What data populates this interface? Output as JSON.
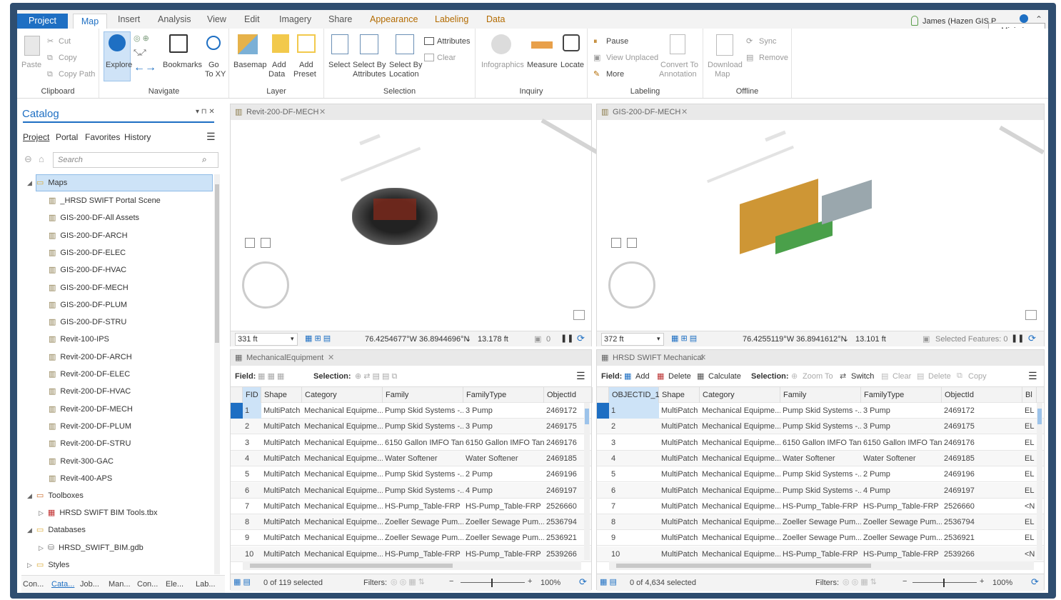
{
  "tabs": [
    "Project",
    "Map",
    "Insert",
    "Analysis",
    "View",
    "Edit",
    "Imagery",
    "Share",
    "Appearance",
    "Labeling",
    "Data"
  ],
  "user": "James (Hazen GIS P",
  "tooltip": "Minimize",
  "ribbon": {
    "clipboard": {
      "label": "Clipboard",
      "paste": "Paste",
      "cut": "Cut",
      "copy": "Copy",
      "copy_path": "Copy Path"
    },
    "navigate": {
      "label": "Navigate",
      "explore": "Explore",
      "bookmarks": "Bookmarks",
      "go": "Go",
      "to_xy": "To XY"
    },
    "layer": {
      "label": "Layer",
      "basemap": "Basemap",
      "add": "Add",
      "data": "Data",
      "add2": "Add",
      "preset": "Preset"
    },
    "selection": {
      "label": "Selection",
      "select": "Select",
      "select_by": "Select By",
      "attributes": "Attributes",
      "select_by2": "Select By",
      "location": "Location",
      "attributes_btn": "Attributes",
      "clear": "Clear"
    },
    "inquiry": {
      "label": "Inquiry",
      "infographics": "Infographics",
      "measure": "Measure",
      "locate": "Locate"
    },
    "labeling": {
      "label": "Labeling",
      "pause": "Pause",
      "view_unplaced": "View Unplaced",
      "more": "More",
      "convert_to": "Convert To",
      "annotation": "Annotation"
    },
    "offline": {
      "label": "Offline",
      "download": "Download",
      "map": "Map",
      "sync": "Sync",
      "remove": "Remove"
    }
  },
  "catalog": {
    "title": "Catalog",
    "tabs": [
      "Project",
      "Portal",
      "Favorites",
      "History"
    ],
    "search_placeholder": "Search",
    "maps_label": "Maps",
    "maps": [
      "_HRSD SWIFT Portal Scene",
      "GIS-200-DF-All Assets",
      "GIS-200-DF-ARCH",
      "GIS-200-DF-ELEC",
      "GIS-200-DF-HVAC",
      "GIS-200-DF-MECH",
      "GIS-200-DF-PLUM",
      "GIS-200-DF-STRU",
      "Revit-100-IPS",
      "Revit-200-DF-ARCH",
      "Revit-200-DF-ELEC",
      "Revit-200-DF-HVAC",
      "Revit-200-DF-MECH",
      "Revit-200-DF-PLUM",
      "Revit-200-DF-STRU",
      "Revit-300-GAC",
      "Revit-400-APS"
    ],
    "toolboxes_label": "Toolboxes",
    "toolbox": "HRSD SWIFT BIM Tools.tbx",
    "databases_label": "Databases",
    "database": "HRSD_SWIFT_BIM.gdb",
    "styles_label": "Styles",
    "bottom_tabs": [
      "Con...",
      "Cata...",
      "Job...",
      "Man...",
      "Con...",
      "Ele...",
      "Lab..."
    ]
  },
  "view_left": {
    "title": "Revit-200-DF-MECH",
    "scale": "331 ft",
    "coords": "76.4254677°W 36.8944696°N",
    "elev": "13.178 ft",
    "count": "0"
  },
  "view_right": {
    "title": "GIS-200-DF-MECH",
    "scale": "372 ft",
    "coords": "76.4255119°W 36.8941612°N",
    "elev": "13.101 ft",
    "selected": "Selected Features: 0"
  },
  "table_left": {
    "title": "MechanicalEquipment",
    "field_label": "Field:",
    "selection_label": "Selection:",
    "columns": [
      "FID",
      "Shape",
      "Category",
      "Family",
      "FamilyType",
      "ObjectId"
    ],
    "rows": [
      [
        "1",
        "MultiPatch",
        "Mechanical Equipme...",
        "Pump Skid Systems -...",
        "3 Pump",
        "2469172"
      ],
      [
        "2",
        "MultiPatch",
        "Mechanical Equipme...",
        "Pump Skid Systems -...",
        "3 Pump",
        "2469175"
      ],
      [
        "3",
        "MultiPatch",
        "Mechanical Equipme...",
        "6150 Gallon IMFO Tank",
        "6150 Gallon IMFO Tank",
        "2469176"
      ],
      [
        "4",
        "MultiPatch",
        "Mechanical Equipme...",
        "Water Softener",
        "Water Softener",
        "2469185"
      ],
      [
        "5",
        "MultiPatch",
        "Mechanical Equipme...",
        "Pump Skid Systems -...",
        "2 Pump",
        "2469196"
      ],
      [
        "6",
        "MultiPatch",
        "Mechanical Equipme...",
        "Pump Skid Systems -...",
        "4 Pump",
        "2469197"
      ],
      [
        "7",
        "MultiPatch",
        "Mechanical Equipme...",
        "HS-Pump_Table-FRP",
        "HS-Pump_Table-FRP",
        "2526660"
      ],
      [
        "8",
        "MultiPatch",
        "Mechanical Equipme...",
        "Zoeller Sewage Pum...",
        "Zoeller Sewage Pum...",
        "2536794"
      ],
      [
        "9",
        "MultiPatch",
        "Mechanical Equipme...",
        "Zoeller Sewage Pum...",
        "Zoeller Sewage Pum...",
        "2536921"
      ],
      [
        "10",
        "MultiPatch",
        "Mechanical Equipme...",
        "HS-Pump_Table-FRP",
        "HS-Pump_Table-FRP",
        "2539266"
      ]
    ],
    "status": "0 of 119 selected",
    "filters": "Filters:",
    "zoom": "100%"
  },
  "table_right": {
    "title": "HRSD SWIFT Mechanical",
    "field_label": "Field:",
    "add": "Add",
    "delete": "Delete",
    "calculate": "Calculate",
    "selection_label": "Selection:",
    "zoom_to": "Zoom To",
    "switch": "Switch",
    "clear": "Clear",
    "delete2": "Delete",
    "copy": "Copy",
    "columns": [
      "OBJECTID_1",
      "Shape",
      "Category",
      "Family",
      "FamilyType",
      "ObjectId",
      "Bl"
    ],
    "rows": [
      [
        "1",
        "MultiPatch",
        "Mechanical Equipme...",
        "Pump Skid Systems -...",
        "3 Pump",
        "2469172",
        "EL"
      ],
      [
        "2",
        "MultiPatch",
        "Mechanical Equipme...",
        "Pump Skid Systems -...",
        "3 Pump",
        "2469175",
        "EL"
      ],
      [
        "3",
        "MultiPatch",
        "Mechanical Equipme...",
        "6150 Gallon IMFO Tank",
        "6150 Gallon IMFO Tank",
        "2469176",
        "EL"
      ],
      [
        "4",
        "MultiPatch",
        "Mechanical Equipme...",
        "Water Softener",
        "Water Softener",
        "2469185",
        "EL"
      ],
      [
        "5",
        "MultiPatch",
        "Mechanical Equipme...",
        "Pump Skid Systems -...",
        "2 Pump",
        "2469196",
        "EL"
      ],
      [
        "6",
        "MultiPatch",
        "Mechanical Equipme...",
        "Pump Skid Systems -...",
        "4 Pump",
        "2469197",
        "EL"
      ],
      [
        "7",
        "MultiPatch",
        "Mechanical Equipme...",
        "HS-Pump_Table-FRP",
        "HS-Pump_Table-FRP",
        "2526660",
        "<N"
      ],
      [
        "8",
        "MultiPatch",
        "Mechanical Equipme...",
        "Zoeller Sewage Pum...",
        "Zoeller Sewage Pum...",
        "2536794",
        "EL"
      ],
      [
        "9",
        "MultiPatch",
        "Mechanical Equipme...",
        "Zoeller Sewage Pum...",
        "Zoeller Sewage Pum...",
        "2536921",
        "EL"
      ],
      [
        "10",
        "MultiPatch",
        "Mechanical Equipme...",
        "HS-Pump_Table-FRP",
        "HS-Pump_Table-FRP",
        "2539266",
        "<N"
      ]
    ],
    "status": "0 of 4,634 selected",
    "filters": "Filters:",
    "zoom": "100%"
  },
  "colors": {
    "accent": "#1e6fc3",
    "frame": "#2f4e70",
    "selection": "#cde3f7"
  }
}
